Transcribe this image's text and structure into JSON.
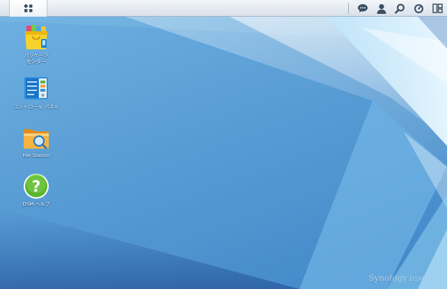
{
  "taskbar": {
    "main_menu_icon": "apps-grid-icon",
    "tray": [
      {
        "name": "chat-icon"
      },
      {
        "name": "user-icon"
      },
      {
        "name": "search-icon"
      },
      {
        "name": "dashboard-gauge-icon"
      },
      {
        "name": "widgets-icon"
      }
    ]
  },
  "desktop": {
    "icons": [
      {
        "icon": "package-center-icon",
        "label": "パッケージ\nセンター"
      },
      {
        "icon": "control-panel-icon",
        "label": "コントロール パネル"
      },
      {
        "icon": "file-station-icon",
        "label": "File Station"
      },
      {
        "icon": "help-icon",
        "label": "DSM ヘルプ"
      }
    ]
  },
  "watermark": {
    "brand": "Synology",
    "version": "DSM 5.2"
  },
  "colors": {
    "taskbar_bg": "#e6ecf2",
    "desktop_bg": "#5b9fd6",
    "help_green": "#5cb52e",
    "folder_orange": "#f2a23a"
  }
}
